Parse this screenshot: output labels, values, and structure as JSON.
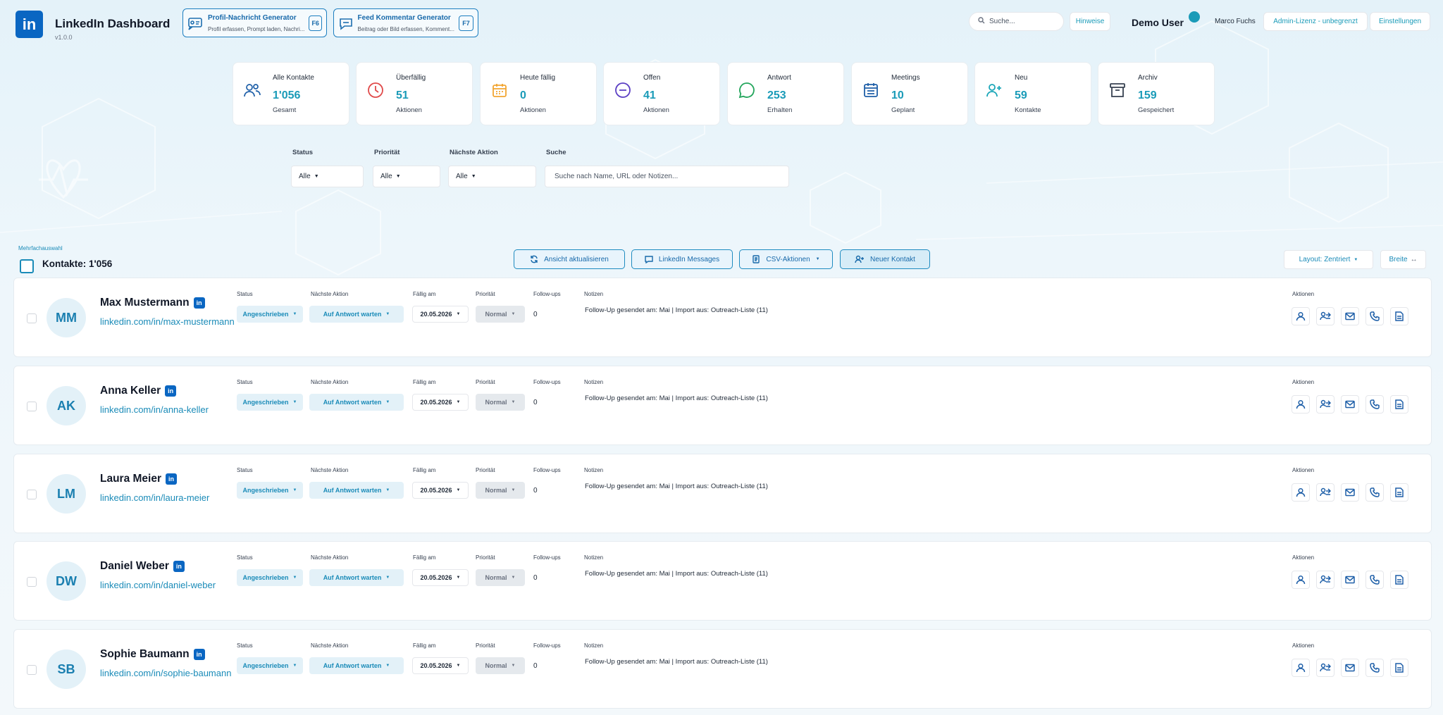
{
  "app": {
    "logo_text": "in",
    "title": "LinkedIn Dashboard",
    "version": "v1.0.0"
  },
  "generators": [
    {
      "title": "Profil-Nachricht Generator",
      "subtitle": "Profil erfassen, Prompt laden, Nachri...",
      "key": "F6",
      "icon": "profile-message-icon"
    },
    {
      "title": "Feed Kommentar Generator",
      "subtitle": "Beitrag oder Bild erfassen, Komment...",
      "key": "F7",
      "icon": "chat-bubble-icon"
    }
  ],
  "header": {
    "search_placeholder": "Suche...",
    "hints_label": "Hinweise",
    "user_name": "Demo User",
    "other_user": "Marco Fuchs",
    "license_label": "Admin-Lizenz - unbegrenzt",
    "settings_label": "Einstellungen"
  },
  "stats": [
    {
      "label": "Alle Kontakte",
      "value": "1'056",
      "sub": "Gesamt",
      "icon": "users-icon",
      "color": "#1e5fa8"
    },
    {
      "label": "Überfällig",
      "value": "51",
      "sub": "Aktionen",
      "icon": "clock-icon",
      "color": "#e04a4a"
    },
    {
      "label": "Heute fällig",
      "value": "0",
      "sub": "Aktionen",
      "icon": "calendar-icon",
      "color": "#f2a531"
    },
    {
      "label": "Offen",
      "value": "41",
      "sub": "Aktionen",
      "icon": "minus-circle-icon",
      "color": "#5b3fc4"
    },
    {
      "label": "Antwort",
      "value": "253",
      "sub": "Erhalten",
      "icon": "chat-icon",
      "color": "#22a55b"
    },
    {
      "label": "Meetings",
      "value": "10",
      "sub": "Geplant",
      "icon": "calendar-grid-icon",
      "color": "#1e5fa8"
    },
    {
      "label": "Neu",
      "value": "59",
      "sub": "Kontakte",
      "icon": "user-plus-icon",
      "color": "#1aa6b8"
    },
    {
      "label": "Archiv",
      "value": "159",
      "sub": "Gespeichert",
      "icon": "archive-icon",
      "color": "#374151"
    }
  ],
  "filters": {
    "status_label": "Status",
    "status_value": "Alle",
    "priority_label": "Priorität",
    "priority_value": "Alle",
    "next_action_label": "Nächste Aktion",
    "next_action_value": "Alle",
    "search_label": "Suche",
    "search_placeholder": "Suche nach Name, URL oder Notizen..."
  },
  "toolbar": {
    "multi_select_label": "Mehrfachauswahl",
    "count_label": "Kontakte: 1'056",
    "refresh_label": "Ansicht aktualisieren",
    "messages_label": "LinkedIn Messages",
    "csv_label": "CSV-Aktionen",
    "new_contact_label": "Neuer Kontakt",
    "layout_label": "Layout: Zentriert",
    "width_label": "Breite"
  },
  "columns": {
    "status": "Status",
    "next_action": "Nächste Aktion",
    "due": "Fällig am",
    "priority": "Priorität",
    "followups": "Follow-ups",
    "notes": "Notizen",
    "actions": "Aktionen"
  },
  "contacts": [
    {
      "initials": "MM",
      "name": "Max Mustermann",
      "url": "linkedin.com/in/max-mustermann",
      "status": "Angeschrieben",
      "next_action": "Auf Antwort warten",
      "due": "20.05.2026",
      "priority": "Normal",
      "followups": "0",
      "notes": "Follow-Up gesendet am: Mai | Import aus: Outreach-Liste (11)"
    },
    {
      "initials": "AK",
      "name": "Anna Keller",
      "url": "linkedin.com/in/anna-keller",
      "status": "Angeschrieben",
      "next_action": "Auf Antwort warten",
      "due": "20.05.2026",
      "priority": "Normal",
      "followups": "0",
      "notes": "Follow-Up gesendet am: Mai | Import aus: Outreach-Liste (11)"
    },
    {
      "initials": "LM",
      "name": "Laura Meier",
      "url": "linkedin.com/in/laura-meier",
      "status": "Angeschrieben",
      "next_action": "Auf Antwort warten",
      "due": "20.05.2026",
      "priority": "Normal",
      "followups": "0",
      "notes": "Follow-Up gesendet am: Mai | Import aus: Outreach-Liste (11)"
    },
    {
      "initials": "DW",
      "name": "Daniel Weber",
      "url": "linkedin.com/in/daniel-weber",
      "status": "Angeschrieben",
      "next_action": "Auf Antwort warten",
      "due": "20.05.2026",
      "priority": "Normal",
      "followups": "0",
      "notes": "Follow-Up gesendet am: Mai | Import aus: Outreach-Liste (11)"
    },
    {
      "initials": "SB",
      "name": "Sophie Baumann",
      "url": "linkedin.com/in/sophie-baumann",
      "status": "Angeschrieben",
      "next_action": "Auf Antwort warten",
      "due": "20.05.2026",
      "priority": "Normal",
      "followups": "0",
      "notes": "Follow-Up gesendet am: Mai | Import aus: Outreach-Liste (11)"
    }
  ],
  "row_actions": [
    "open-profile-icon",
    "assign-icon",
    "mail-icon",
    "phone-icon",
    "document-icon"
  ]
}
